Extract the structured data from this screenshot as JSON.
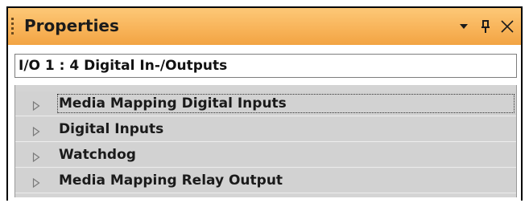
{
  "window": {
    "title": "Properties"
  },
  "selector": {
    "value": "I/O 1 : 4 Digital In-/Outputs"
  },
  "categories": [
    {
      "label": "Media Mapping Digital Inputs",
      "expanded": false,
      "selected": true
    },
    {
      "label": "Digital Inputs",
      "expanded": false,
      "selected": false
    },
    {
      "label": "Watchdog",
      "expanded": false,
      "selected": false
    },
    {
      "label": "Media Mapping Relay Output",
      "expanded": false,
      "selected": false
    }
  ],
  "colors": {
    "titlebar_accent": "#f8b45a",
    "grid_background": "#d2d2d2"
  },
  "icons": {
    "titlebar": [
      "chevron-down-icon",
      "pin-icon",
      "close-icon"
    ],
    "row_expander": "expand-arrow-icon"
  }
}
